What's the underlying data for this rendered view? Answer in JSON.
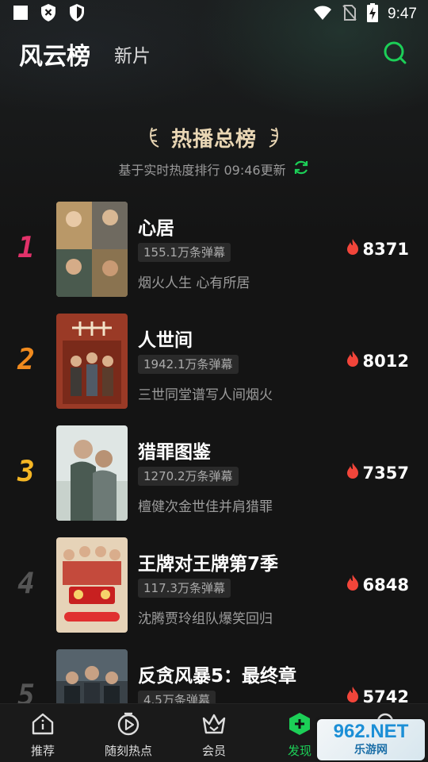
{
  "status_bar": {
    "time": "9:47",
    "icons": [
      "square-icon",
      "shield-x-icon",
      "shield-check-icon",
      "wifi-icon",
      "no-sim-icon",
      "battery-charging-icon"
    ]
  },
  "header": {
    "active_tab": "风云榜",
    "second_tab": "新片",
    "search_icon": "search-icon",
    "accent_color": "#1ccf57"
  },
  "board": {
    "title": "热播总榜",
    "subtitle": "基于实时热度排行 09:46更新"
  },
  "rank_colors": [
    "#e2326a",
    "#f08a1e",
    "#f5b624",
    "#555555",
    "#555555"
  ],
  "items": [
    {
      "rank": "1",
      "title": "心居",
      "danmu": "155.1万条弹幕",
      "desc": "烟火人生 心有所居",
      "heat": "8371"
    },
    {
      "rank": "2",
      "title": "人世间",
      "danmu": "1942.1万条弹幕",
      "desc": "三世同堂谱写人间烟火",
      "heat": "8012"
    },
    {
      "rank": "3",
      "title": "猎罪图鉴",
      "danmu": "1270.2万条弹幕",
      "desc": "檀健次金世佳并肩猎罪",
      "heat": "7357"
    },
    {
      "rank": "4",
      "title": "王牌对王牌第7季",
      "danmu": "117.3万条弹幕",
      "desc": "沈腾贾玲组队爆笑回归",
      "heat": "6848"
    },
    {
      "rank": "5",
      "title": "反贪风暴5：最终章",
      "danmu": "4.5万条弹幕",
      "desc": "",
      "heat": "5742"
    }
  ],
  "bottom_nav": [
    {
      "label": "推荐",
      "icon": "home-icon"
    },
    {
      "label": "随刻热点",
      "icon": "play-circle-icon"
    },
    {
      "label": "会员",
      "icon": "crown-icon"
    },
    {
      "label": "发现",
      "icon": "discover-plus-icon"
    },
    {
      "label": "",
      "icon": "profile-icon"
    }
  ],
  "watermark": {
    "top": "962.NET",
    "bottom": "乐游网"
  }
}
